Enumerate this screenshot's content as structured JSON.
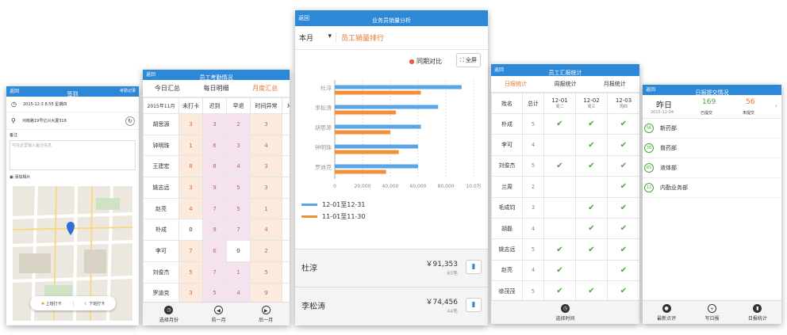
{
  "s1": {
    "back": "返回",
    "title": "签到",
    "right": "考勤记录",
    "time": "2015-12-3  8:55  星期四",
    "addr": "河南路19号亿兴大厦318",
    "note_label": "备注",
    "note_ph": "可在这里输入备注信息",
    "photo": "添加相片",
    "btn_in": "上班打卡",
    "btn_out": "下班打卡"
  },
  "s2": {
    "back": "返回",
    "title": "员工考勤情况",
    "tabs": [
      "今日汇总",
      "每日明细",
      "月度汇总"
    ],
    "headers": [
      "2015年11月",
      "未打卡",
      "迟到",
      "早退",
      "时间异常",
      "地"
    ],
    "rows": [
      [
        "胡思源",
        "3",
        "3",
        "2",
        "3"
      ],
      [
        "钟明珠",
        "1",
        "6",
        "3",
        "4"
      ],
      [
        "王建宏",
        "8",
        "8",
        "4",
        "3"
      ],
      [
        "姚志远",
        "3",
        "9",
        "5",
        "3"
      ],
      [
        "赵亮",
        "4",
        "7",
        "5",
        "1"
      ],
      [
        "朴成",
        "0",
        "9",
        "7",
        "4"
      ],
      [
        "李可",
        "7",
        "6",
        "0",
        "2"
      ],
      [
        "刘俊杰",
        "5",
        "7",
        "1",
        "5"
      ],
      [
        "罗迪克",
        "3",
        "5",
        "4",
        "9"
      ]
    ],
    "bottom": [
      "选择月份",
      "前一月",
      "后一月"
    ]
  },
  "s3": {
    "back": "返回",
    "title": "业务员销量分析",
    "month": "本月",
    "section": "员工销量排行",
    "compare": "同期对比",
    "full": "全屏",
    "legend": [
      "12-01至12-31",
      "11-01至11-30"
    ],
    "colors": [
      "#5aa4e8",
      "#f0913a"
    ],
    "people": [
      {
        "name": "杜淳",
        "amount": "￥91,353",
        "count": "65笔"
      },
      {
        "name": "李松涛",
        "amount": "￥74,456",
        "count": "44笔"
      }
    ]
  },
  "chart_data": {
    "type": "bar",
    "orientation": "horizontal",
    "categories": [
      "杜淳",
      "李松涛",
      "胡思源",
      "钟明珠",
      "罗迪克"
    ],
    "x_ticks": [
      "0",
      "20,000",
      "40,000",
      "60,000",
      "80,000",
      "10.0万"
    ],
    "xlim": [
      0,
      100000
    ],
    "series": [
      {
        "name": "12-01至12-31",
        "values": [
          91353,
          74456,
          62000,
          60000,
          60000
        ]
      },
      {
        "name": "11-01至11-30",
        "values": [
          62000,
          44000,
          40000,
          46000,
          37000
        ]
      }
    ],
    "legend_position": "bottom"
  },
  "s4": {
    "back": "返回",
    "title": "员工汇报统计",
    "tabs": [
      "日报统计",
      "周报统计",
      "月报统计"
    ],
    "cols": [
      {
        "a": "姓名",
        "b": ""
      },
      {
        "a": "总计",
        "b": ""
      },
      {
        "a": "12-01",
        "b": "周二"
      },
      {
        "a": "12-02",
        "b": "周三"
      },
      {
        "a": "12-03",
        "b": "周四"
      }
    ],
    "rows": [
      {
        "name": "朴成",
        "total": "5",
        "c": [
          1,
          1,
          1
        ]
      },
      {
        "name": "李可",
        "total": "4",
        "c": [
          0,
          1,
          1
        ]
      },
      {
        "name": "刘俊杰",
        "total": "5",
        "c": [
          1,
          1,
          1
        ]
      },
      {
        "name": "兰周",
        "total": "2",
        "c": [
          0,
          0,
          1
        ]
      },
      {
        "name": "毛成钧",
        "total": "3",
        "c": [
          0,
          1,
          1
        ]
      },
      {
        "name": "胡磊",
        "total": "4",
        "c": [
          0,
          1,
          1
        ]
      },
      {
        "name": "姚志远",
        "total": "5",
        "c": [
          1,
          1,
          1
        ]
      },
      {
        "name": "赵亮",
        "total": "4",
        "c": [
          1,
          0,
          1
        ]
      },
      {
        "name": "徐茂茂",
        "total": "5",
        "c": [
          1,
          1,
          1
        ]
      }
    ],
    "bottom": "选择时间"
  },
  "s5": {
    "back": "返回",
    "title": "日报提交情况",
    "day": "昨日",
    "date": "2015-12-04",
    "submitted": "169",
    "submitted_label": "已提交",
    "unsub": "56",
    "unsub_label": "未提交",
    "depts": [
      {
        "n": "56",
        "name": "新药部"
      },
      {
        "n": "38",
        "name": "普药部"
      },
      {
        "n": "65",
        "name": "液体部"
      },
      {
        "n": "12",
        "name": "内勤业务部"
      }
    ],
    "bottom": [
      "最新点评",
      "写日报",
      "日报统计"
    ]
  }
}
